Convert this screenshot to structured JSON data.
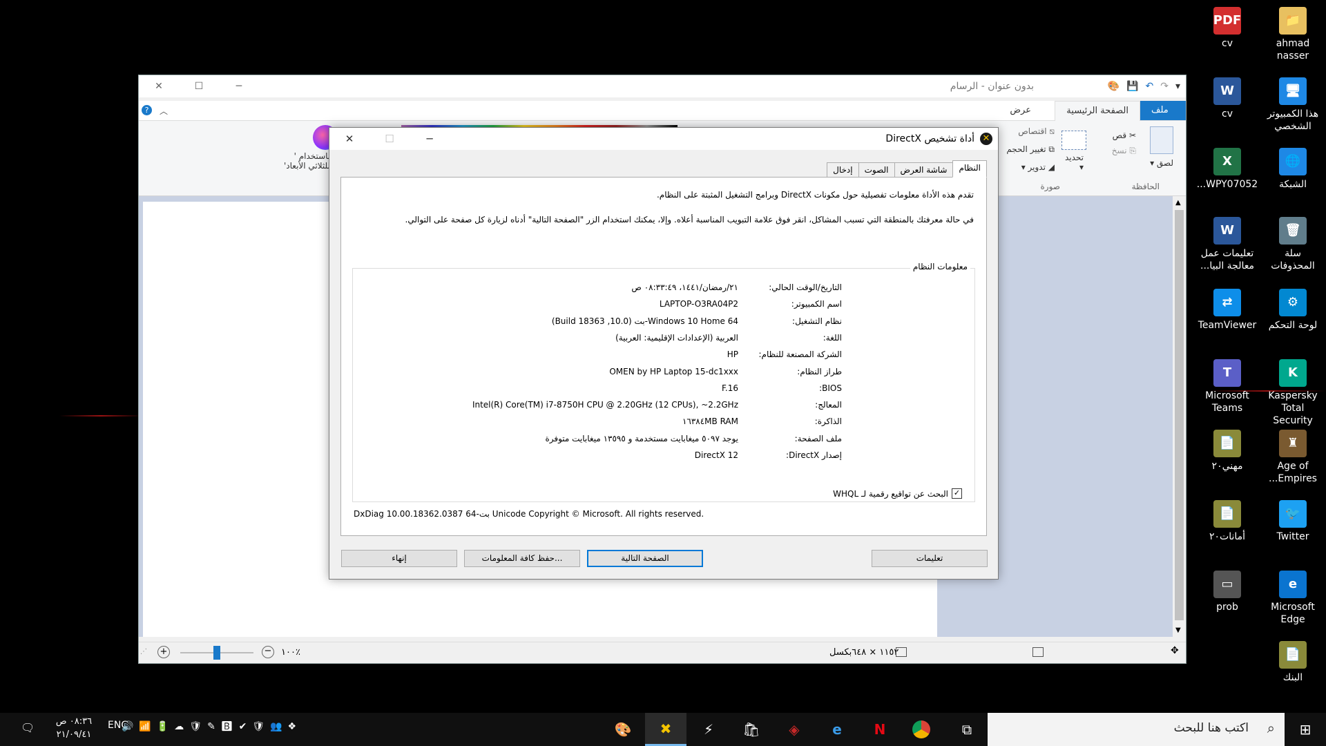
{
  "desktop": {
    "icons": [
      {
        "label": "ahmad nasser",
        "label2": "",
        "color": "#e8c060",
        "glyph": "📁"
      },
      {
        "label": "cv",
        "label2": "",
        "color": "#d32f2f",
        "glyph": "PDF"
      },
      {
        "label": "هذا الكمبيوتر",
        "label2": "الشخصي",
        "color": "#1e88e5",
        "glyph": "🖥"
      },
      {
        "label": "cv",
        "label2": "",
        "color": "#2b579a",
        "glyph": "W"
      },
      {
        "label": "الشبكة",
        "label2": "",
        "color": "#1e88e5",
        "glyph": "🌐"
      },
      {
        "label": "WPY07052...",
        "label2": "",
        "color": "#217346",
        "glyph": "X"
      },
      {
        "label": "سلة",
        "label2": "المحذوفات",
        "color": "#607d8b",
        "glyph": "🗑"
      },
      {
        "label": "تعليمات عمل",
        "label2": "معالجة البيا...",
        "color": "#2b579a",
        "glyph": "W"
      },
      {
        "label": "لوحة التحكم",
        "label2": "",
        "color": "#0288d1",
        "glyph": "⚙"
      },
      {
        "label": "TeamViewer",
        "label2": "",
        "color": "#0e8ee9",
        "glyph": "⇄"
      },
      {
        "label": "Kaspersky",
        "label2": "Total Security",
        "color": "#00a88e",
        "glyph": "K"
      },
      {
        "label": "Microsoft",
        "label2": "Teams",
        "color": "#5b5fc7",
        "glyph": "T"
      },
      {
        "label": "Age of",
        "label2": "Empires...",
        "color": "#7a5a30",
        "glyph": "♜"
      },
      {
        "label": "مهني٢٠",
        "label2": "",
        "color": "#8a8a3a",
        "glyph": "📄"
      },
      {
        "label": "Twitter",
        "label2": "",
        "color": "#1da1f2",
        "glyph": "🐦"
      },
      {
        "label": "أمانات٢٠",
        "label2": "",
        "color": "#8a8a3a",
        "glyph": "📄"
      },
      {
        "label": "Microsoft",
        "label2": "Edge",
        "color": "#0a74d0",
        "glyph": "e"
      },
      {
        "label": "prob",
        "label2": "",
        "color": "#555",
        "glyph": "▭"
      },
      {
        "label": "البنك",
        "label2": "",
        "color": "#8a8a3a",
        "glyph": "📄"
      }
    ]
  },
  "paint": {
    "title": "بدون عنوان - الرسام",
    "tabs": {
      "file": "ملف",
      "home": "الصفحة الرئيسية",
      "view": "عرض"
    },
    "ribbon": {
      "paste": "لصق",
      "cut": "قص",
      "copy": "نسخ",
      "clipboard_group": "الحافظة",
      "select": "تحديد",
      "crop": "اقتصاص",
      "resize": "تغيير الحجم",
      "rotate": "تدوير",
      "image_group": "صورة",
      "paint3d_line1": "باستخدام '",
      "paint3d_line2": "للثلاثي الأبعاد'"
    },
    "status": {
      "size": "١١٥٢ × ٦٤٨بكسل",
      "zoom": "١٠٠٪"
    },
    "zoom_level": 0.5
  },
  "dxdiag": {
    "title": "أداة تشخيص DirectX",
    "tabs": [
      "النظام",
      "شاشة العرض",
      "الصوت",
      "إدخال"
    ],
    "intro1": "تقدم هذه الأداة معلومات تفصيلية حول مكونات DirectX وبرامج التشغيل المثبتة على النظام.",
    "intro2": "في حالة معرفتك بالمنطقة التي تسبب المشاكل، انقر فوق علامة التبويب المناسبة أعلاه.  وإلا، يمكنك استخدام الزر \"الصفحة التالية\" أدناه لزيارة كل صفحة على التوالي.",
    "group_title": "معلومات النظام",
    "rows": [
      {
        "label": "التاريخ/الوقت الحالي:",
        "value": "٢١/رمضان/١٤٤١، ٠٨:٣٣:٤٩ ص"
      },
      {
        "label": "اسم الكمبيوتر:",
        "value": "LAPTOP-O3RA04P2"
      },
      {
        "label": "نظام التشغيل:",
        "value": "Windows 10 Home 64-بت (10.0, Build 18363)"
      },
      {
        "label": "اللغة:",
        "value": "العربية (الإعدادات الإقليمية: العربية)"
      },
      {
        "label": "الشركة المصنعة للنظام:",
        "value": "HP"
      },
      {
        "label": "طراز النظام:",
        "value": "OMEN by HP Laptop 15-dc1xxx"
      },
      {
        "label": "BIOS:",
        "value": "F.16"
      },
      {
        "label": "المعالج:",
        "value": "Intel(R) Core(TM) i7-8750H CPU @ 2.20GHz (12 CPUs), ~2.2GHz"
      },
      {
        "label": "الذاكرة:",
        "value": "١٦٣٨٤MB RAM"
      },
      {
        "label": "ملف الصفحة:",
        "value": "يوجد ٥٠٩٧ ميغابايت مستخدمة و ١٣٥٩٥ ميغابايت متوفرة"
      },
      {
        "label": "إصدار DirectX:",
        "value": "DirectX 12"
      }
    ],
    "whql": "البحث عن تواقيع رقمية لـ WHQL",
    "copyright": "DxDiag 10.00.18362.0387 64-بت Unicode  Copyright © Microsoft. All rights reserved.",
    "buttons": {
      "help": "تعليمات",
      "next": "الصفحة التالية",
      "save": "حفظ كافة المعلومات...",
      "exit": "إنهاء"
    }
  },
  "taskbar": {
    "search_placeholder": "اكتب هنا للبحث",
    "lang": "ENG",
    "time": "٠٨:٣٦ ص",
    "date": "٢١/٠٩/٤١"
  }
}
